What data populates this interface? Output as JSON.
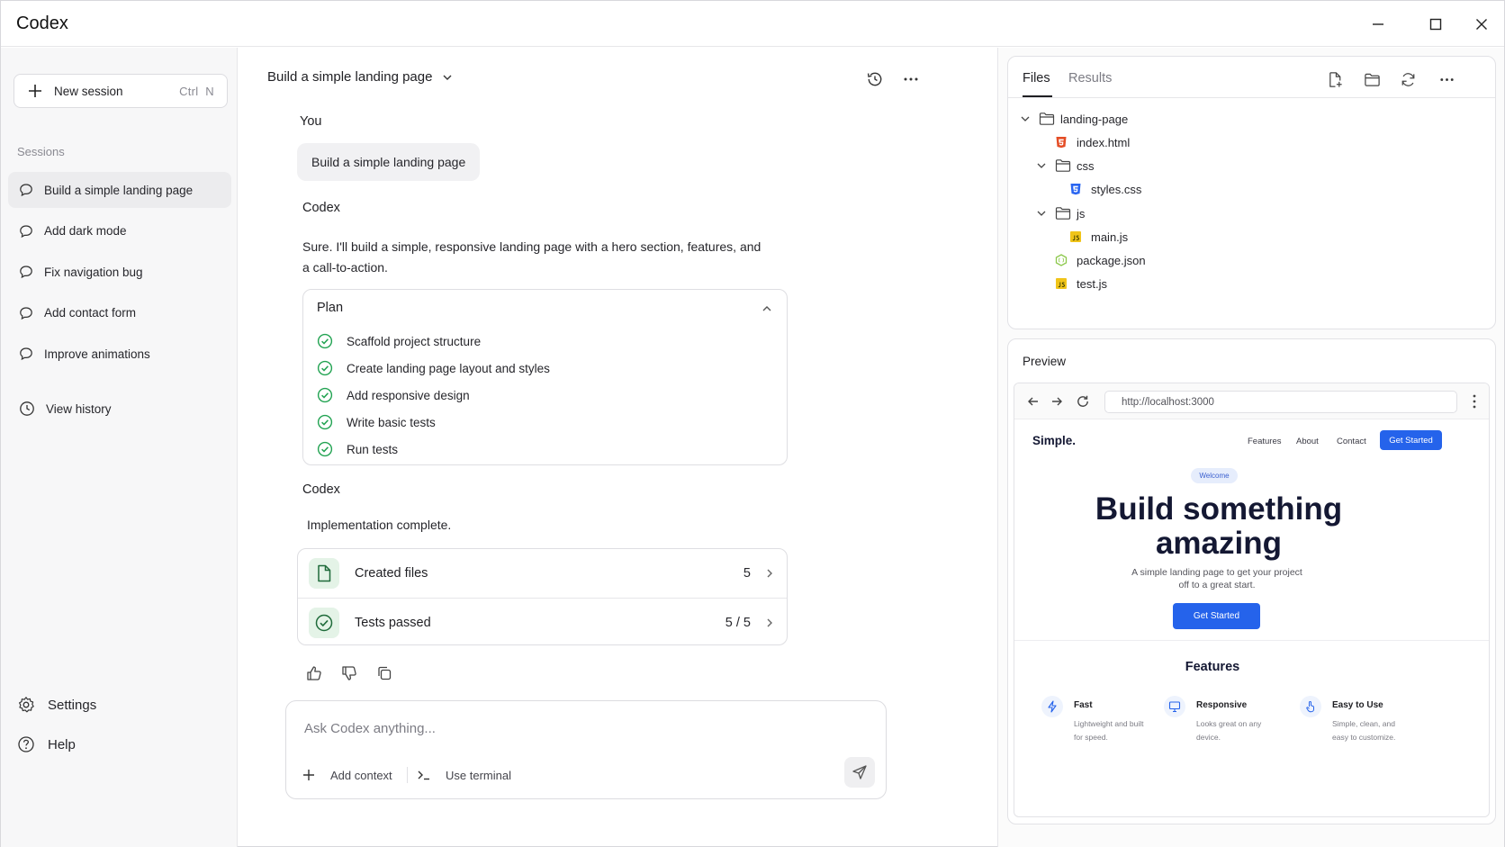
{
  "app": {
    "title": "Codex"
  },
  "sidebar": {
    "new_session_label": "New session",
    "new_session_shortcut": "Ctrl  N",
    "sessions_title": "Sessions",
    "sessions": [
      {
        "label": "Build a simple landing page",
        "active": true
      },
      {
        "label": "Add dark mode"
      },
      {
        "label": "Fix navigation bug"
      },
      {
        "label": "Add contact form"
      },
      {
        "label": "Improve animations"
      }
    ],
    "view_history": "View history",
    "settings": "Settings",
    "help": "Help"
  },
  "chat": {
    "title": "Build a simple landing page",
    "user_label": "You",
    "user_message": "Build a simple landing page",
    "codex_label": "Codex",
    "codex_message": "Sure. I'll build a simple, responsive landing page with a hero section, features, and a call-to-action.",
    "plan": {
      "title": "Plan",
      "items": [
        "Scaffold project structure",
        "Create landing page layout and styles",
        "Add responsive design",
        "Write basic tests",
        "Run tests"
      ]
    },
    "codex_label_2": "Codex",
    "impl_message": "Implementation complete.",
    "results": [
      {
        "label": "Created files",
        "count": "5"
      },
      {
        "label": "Tests passed",
        "count": "5 / 5"
      }
    ],
    "composer": {
      "placeholder": "Ask Codex anything...",
      "add_context": "Add context",
      "use_terminal": "Use terminal"
    }
  },
  "files": {
    "tabs": [
      "Files",
      "Results"
    ],
    "tree": [
      {
        "name": "landing-page",
        "type": "folder",
        "expanded": true,
        "depth": 0
      },
      {
        "name": "index.html",
        "type": "html",
        "depth": 1
      },
      {
        "name": "css",
        "type": "folder",
        "expanded": true,
        "depth": 1
      },
      {
        "name": "styles.css",
        "type": "css",
        "depth": 2
      },
      {
        "name": "js",
        "type": "folder",
        "expanded": true,
        "depth": 1
      },
      {
        "name": "main.js",
        "type": "js",
        "depth": 2
      },
      {
        "name": "package.json",
        "type": "json",
        "depth": 1
      },
      {
        "name": "test.js",
        "type": "js",
        "depth": 1
      }
    ]
  },
  "preview": {
    "title": "Preview",
    "url": "http://localhost:3000",
    "site": {
      "logo": "Simple.",
      "nav": [
        "Features",
        "About",
        "Contact"
      ],
      "cta_top": "Get Started",
      "welcome": "Welcome",
      "hero_line1": "Build something",
      "hero_line2": "amazing",
      "subtitle_line1": "A simple landing page to get your project",
      "subtitle_line2": "off to a great start.",
      "cta": "Get Started",
      "features_title": "Features",
      "features": [
        {
          "name": "Fast",
          "desc_line1": "Lightweight and built",
          "desc_line2": "for speed."
        },
        {
          "name": "Responsive",
          "desc_line1": "Looks great on any",
          "desc_line2": "device."
        },
        {
          "name": "Easy to Use",
          "desc_line1": "Simple, clean, and",
          "desc_line2": "easy to customize."
        }
      ]
    }
  },
  "colors": {
    "accent": "#2563eb",
    "success": "#22a352",
    "html_icon": "#e44d26",
    "css_icon": "#2965f1",
    "js_icon": "#f0c419",
    "json_icon": "#8cc84b"
  }
}
